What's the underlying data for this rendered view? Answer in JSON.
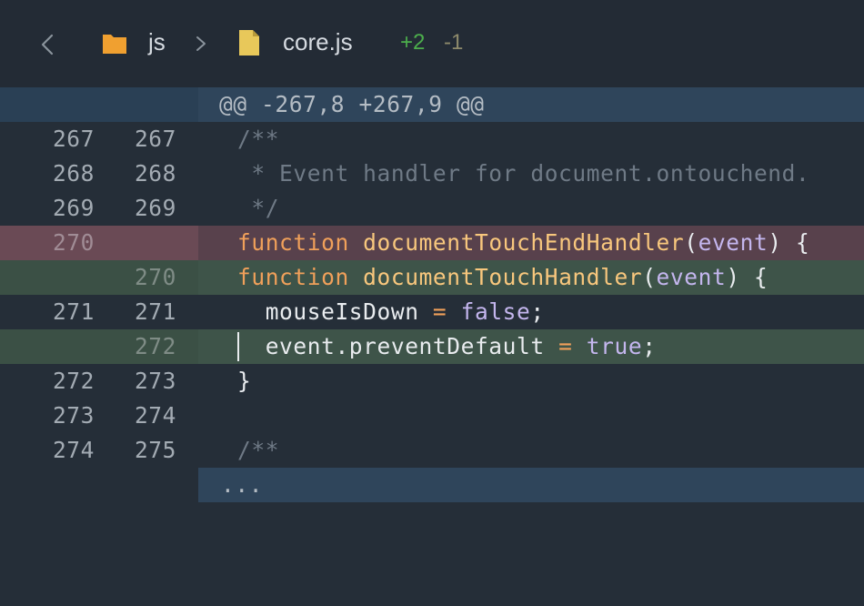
{
  "header": {
    "directory": "js",
    "filename": "core.js",
    "additions": "+2",
    "deletions": "-1",
    "icons": [
      "chevron-left-icon",
      "folder-icon",
      "chevron-right-icon",
      "file-icon"
    ],
    "colors": {
      "folder": "#f0a030",
      "file": "#e8c85a",
      "additions": "#4cae4c",
      "deletions": "#8d8a6b"
    }
  },
  "diff": {
    "hunk_header": "@@ -267,8 +267,9 @@",
    "rows": [
      {
        "type": "context",
        "old": "267",
        "new": "267"
      },
      {
        "type": "context",
        "old": "268",
        "new": "268"
      },
      {
        "type": "context",
        "old": "269",
        "new": "269"
      },
      {
        "type": "deleted",
        "old": "270",
        "new": ""
      },
      {
        "type": "added",
        "old": "",
        "new": "270"
      },
      {
        "type": "context",
        "old": "271",
        "new": "271"
      },
      {
        "type": "added",
        "old": "",
        "new": "272"
      },
      {
        "type": "context",
        "old": "272",
        "new": "273"
      },
      {
        "type": "context",
        "old": "273",
        "new": "274"
      },
      {
        "type": "context",
        "old": "274",
        "new": "275"
      }
    ],
    "code": {
      "c267": "/**",
      "c268": " * Event handler for document.ontouchend.",
      "c269": " */",
      "kw_function": "function",
      "del_fn": "documentTouchEndHandler",
      "add_fn": "documentTouchHandler",
      "paren_open": "(",
      "param": "event",
      "paren_close_brace": ") {",
      "indent": "  ",
      "var_mouse": "mouseIsDown",
      "op_eq": " = ",
      "val_false": "false",
      "semi": ";",
      "var_event_call": "event.preventDefault",
      "val_true": "true",
      "close_brace": "}",
      "c275": "/**"
    },
    "expand_label": "...",
    "colors": {
      "hunk_bg": "#2f455b",
      "deleted_bg": "#58414c",
      "added_bg": "#3e5449",
      "keyword": "#f0a05a",
      "function_name": "#f8c77d",
      "parameter": "#c4b6ee",
      "comment": "#6f7a86"
    }
  }
}
